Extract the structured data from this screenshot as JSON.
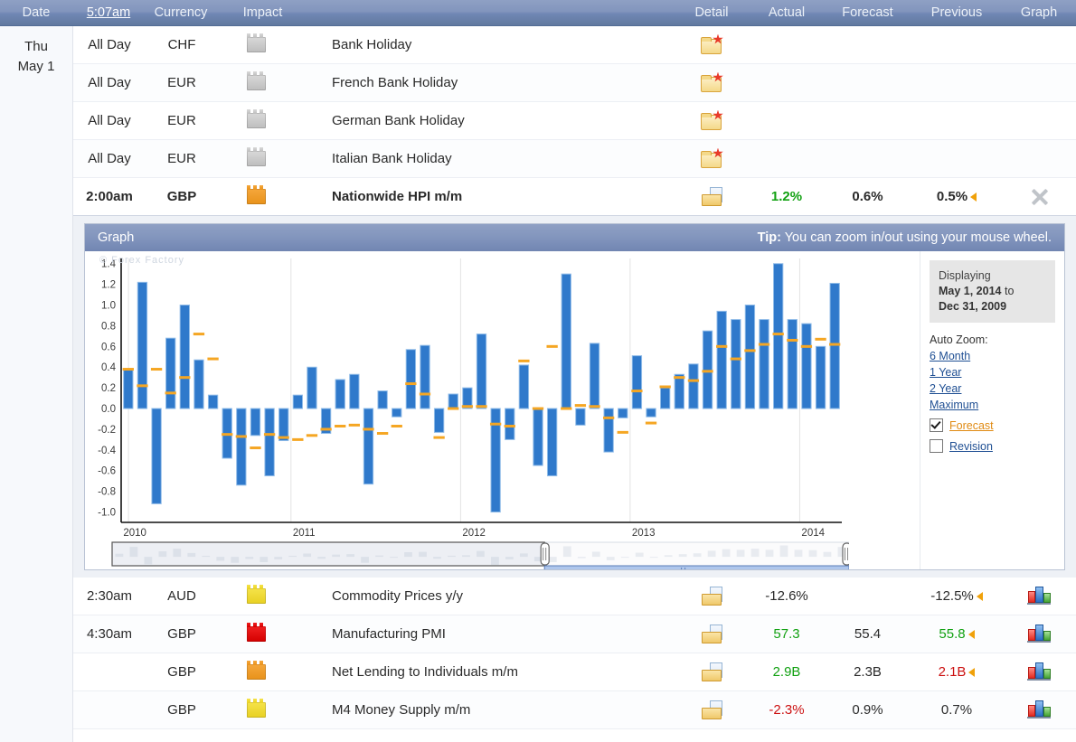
{
  "header": {
    "date": "Date",
    "time": "5:07am",
    "currency": "Currency",
    "impact": "Impact",
    "detail": "Detail",
    "actual": "Actual",
    "forecast": "Forecast",
    "previous": "Previous",
    "graph": "Graph"
  },
  "date_column": {
    "day": "Thu",
    "date": "May 1"
  },
  "rows_top": [
    {
      "time": "All Day",
      "currency": "CHF",
      "impact": "holiday",
      "title": "Bank Holiday",
      "detail_icon": "folder-star-icon",
      "actual": "",
      "forecast": "",
      "previous": "",
      "revised": false,
      "graph_icon": ""
    },
    {
      "time": "All Day",
      "currency": "EUR",
      "impact": "holiday",
      "title": "French Bank Holiday",
      "detail_icon": "folder-star-icon",
      "actual": "",
      "forecast": "",
      "previous": "",
      "revised": false,
      "graph_icon": ""
    },
    {
      "time": "All Day",
      "currency": "EUR",
      "impact": "holiday",
      "title": "German Bank Holiday",
      "detail_icon": "folder-star-icon",
      "actual": "",
      "forecast": "",
      "previous": "",
      "revised": false,
      "graph_icon": ""
    },
    {
      "time": "All Day",
      "currency": "EUR",
      "impact": "holiday",
      "title": "Italian Bank Holiday",
      "detail_icon": "folder-star-icon",
      "actual": "",
      "forecast": "",
      "previous": "",
      "revised": false,
      "graph_icon": ""
    }
  ],
  "expanded_row": {
    "time": "2:00am",
    "currency": "GBP",
    "impact": "medium",
    "title": "Nationwide HPI m/m",
    "detail_icon": "folder-open-page-icon",
    "actual": "1.2%",
    "actual_state": "better",
    "forecast": "0.6%",
    "previous": "0.5%",
    "previous_state": "neutral",
    "revised": true,
    "close_icon": "close-x-icon"
  },
  "graph_panel": {
    "title": "Graph",
    "tip_label": "Tip:",
    "tip_text": "You can zoom in/out using your mouse wheel.",
    "watermark": "© Forex Factory",
    "displaying_label": "Displaying",
    "displaying_from": "May 1, 2014",
    "displaying_to_label": "to",
    "displaying_to": "Dec 31, 2009",
    "auto_zoom_label": "Auto Zoom:",
    "zoom_options": [
      "6 Month",
      "1 Year",
      "2 Year",
      "Maximum"
    ],
    "forecast_label": "Forecast",
    "forecast_checked": true,
    "revision_label": "Revision",
    "revision_checked": false
  },
  "chart_data": {
    "type": "bar",
    "title": "Nationwide HPI m/m",
    "xlabel": "",
    "ylabel": "",
    "ylim": [
      -1.1,
      1.45
    ],
    "yticks": [
      1.4,
      1.2,
      1.0,
      0.8,
      0.6,
      0.4,
      0.2,
      0.0,
      -0.2,
      -0.4,
      -0.6,
      -0.8,
      -1.0
    ],
    "ytick_labels": [
      "1.4",
      "1.2",
      "1.0",
      "0.8",
      "0.6",
      "0.4",
      "0.2",
      "0.0",
      "-0.2",
      "-0.4",
      "-0.6",
      "-0.8",
      "-1.0"
    ],
    "xtick_labels": [
      "2010",
      "2011",
      "2012",
      "2013",
      "2014"
    ],
    "xtick_positions": [
      0,
      12,
      24,
      36,
      48
    ],
    "grid": false,
    "legend": "none",
    "bar_color": "#2f79cb",
    "bar_border_color": "#8fbbe8",
    "forecast_color": "#f5a623",
    "series": [
      {
        "name": "Actual",
        "values": [
          0.38,
          1.22,
          -0.92,
          0.68,
          1.0,
          0.47,
          0.13,
          -0.48,
          -0.74,
          -0.26,
          -0.65,
          -0.31,
          0.13,
          0.4,
          -0.24,
          0.28,
          0.33,
          -0.73,
          0.17,
          -0.08,
          0.57,
          0.61,
          -0.23,
          0.14,
          0.2,
          0.72,
          -1.0,
          -0.3,
          0.42,
          -0.55,
          -0.65,
          1.3,
          -0.16,
          0.63,
          -0.42,
          -0.09,
          0.51,
          -0.08,
          0.2,
          0.33,
          0.43,
          0.75,
          0.94,
          0.86,
          1.0,
          0.86,
          1.4,
          0.86,
          0.82,
          0.6,
          1.21
        ]
      },
      {
        "name": "Forecast",
        "values": [
          0.38,
          0.22,
          0.38,
          0.15,
          0.3,
          0.72,
          0.48,
          -0.25,
          -0.27,
          -0.38,
          -0.25,
          -0.28,
          -0.3,
          -0.26,
          -0.2,
          -0.17,
          -0.16,
          -0.2,
          -0.24,
          -0.17,
          0.24,
          0.14,
          -0.28,
          0.0,
          0.02,
          0.02,
          -0.15,
          -0.17,
          0.46,
          0.0,
          0.6,
          0.0,
          0.03,
          0.02,
          -0.09,
          -0.23,
          0.17,
          -0.14,
          0.21,
          0.3,
          0.27,
          0.36,
          0.6,
          0.48,
          0.56,
          0.62,
          0.72,
          0.66,
          0.6,
          0.67,
          0.62
        ]
      }
    ]
  },
  "rows_bottom": [
    {
      "time": "2:30am",
      "currency": "AUD",
      "impact": "low",
      "title": "Commodity Prices y/y",
      "detail_icon": "folder-open-page-icon",
      "actual": "-12.6%",
      "actual_state": "neutral",
      "forecast": "",
      "previous": "-12.5%",
      "previous_state": "neutral",
      "revised": true,
      "graph_icon": "bar-chart-icon"
    },
    {
      "time": "4:30am",
      "currency": "GBP",
      "impact": "high",
      "title": "Manufacturing PMI",
      "detail_icon": "folder-open-page-icon",
      "actual": "57.3",
      "actual_state": "better",
      "forecast": "55.4",
      "previous": "55.8",
      "previous_state": "better",
      "revised": true,
      "graph_icon": "bar-chart-icon"
    },
    {
      "time": "",
      "currency": "GBP",
      "impact": "medium",
      "title": "Net Lending to Individuals m/m",
      "detail_icon": "folder-open-page-icon",
      "actual": "2.9B",
      "actual_state": "better",
      "forecast": "2.3B",
      "previous": "2.1B",
      "previous_state": "worse",
      "revised": true,
      "graph_icon": "bar-chart-icon"
    },
    {
      "time": "",
      "currency": "GBP",
      "impact": "low",
      "title": "M4 Money Supply m/m",
      "detail_icon": "folder-open-page-icon",
      "actual": "-2.3%",
      "actual_state": "worse",
      "forecast": "0.9%",
      "previous": "0.7%",
      "previous_state": "neutral",
      "revised": false,
      "graph_icon": "bar-chart-icon"
    }
  ]
}
